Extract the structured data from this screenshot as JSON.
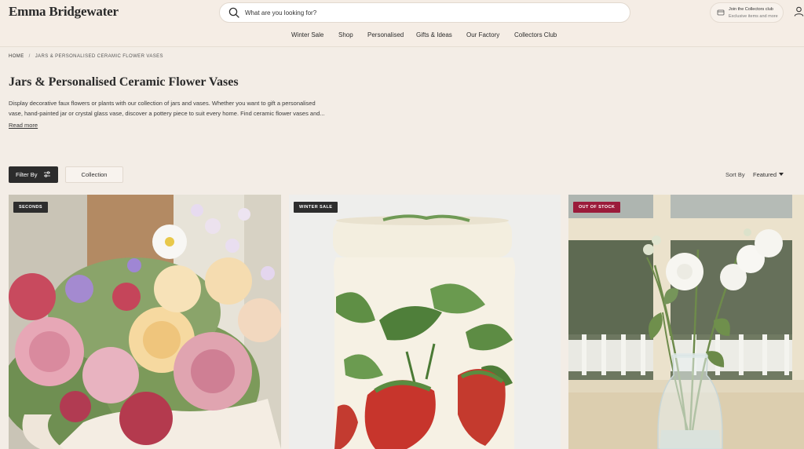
{
  "header": {
    "logo": "Emma Bridgewater",
    "search_placeholder": "What are you looking for?",
    "collectors": {
      "title": "Join the Collectors club",
      "subtitle": "Exclusive items and more"
    }
  },
  "nav": [
    "Winter Sale",
    "Shop",
    "Personalised",
    "Gifts & Ideas",
    "Our Factory",
    "Collectors Club"
  ],
  "breadcrumb": {
    "home": "HOME",
    "sep": "/",
    "current": "JARS & PERSONALISED CERAMIC FLOWER VASES"
  },
  "page": {
    "title": "Jars & Personalised Ceramic Flower Vases",
    "description_lines": [
      "Display decorative faux flowers or plants with our collection of jars and vases. Whether you want to gift a personalised",
      "vase, hand-painted jar or crystal glass vase, discover a pottery piece to suit every home. Find ceramic flower vases and..."
    ],
    "read_more": "Read more"
  },
  "toolbar": {
    "filter_label": "Filter By",
    "collection_label": "Collection",
    "sort_label": "Sort By",
    "sort_value": "Featured"
  },
  "products": [
    {
      "badge": "SECONDS",
      "badge_color": "#2d2d2d"
    },
    {
      "badge": "WINTER SALE",
      "badge_color": "#2d2d2d"
    },
    {
      "badge": "OUT OF STOCK",
      "badge_color": "#9b1b3a"
    }
  ]
}
